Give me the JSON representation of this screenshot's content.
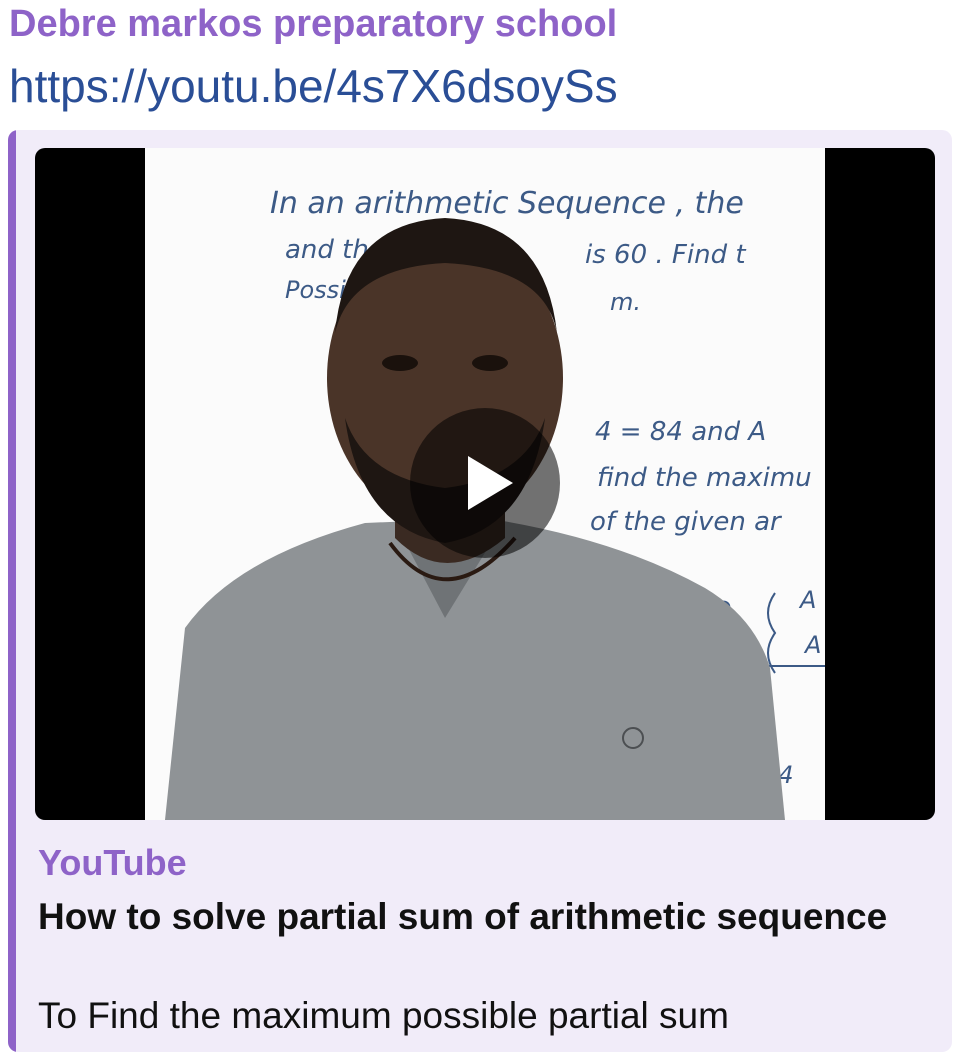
{
  "colors": {
    "accent": "#8e63c8",
    "link": "#2a4e96",
    "preview_background": "#f1ecf9",
    "text": "#111111"
  },
  "message": {
    "sender": "Debre markos preparatory school",
    "link_text": "https://youtu.be/4s7X6dsoySs"
  },
  "link_preview": {
    "site_name": "YouTube",
    "title": "How to solve partial sum of arithmetic sequence",
    "description": "To Find the maximum possible partial sum",
    "thumbnail": {
      "play_icon": "play-icon",
      "whiteboard_lines": [
        "In an arithmetic Sequence , the",
        "and the",
        "is 60 . Find t",
        "Possib",
        "m.",
        "4 = 84  and  A",
        "find  the maximu",
        "of  the given ar",
        "D",
        "A",
        "A",
        "84"
      ]
    }
  }
}
